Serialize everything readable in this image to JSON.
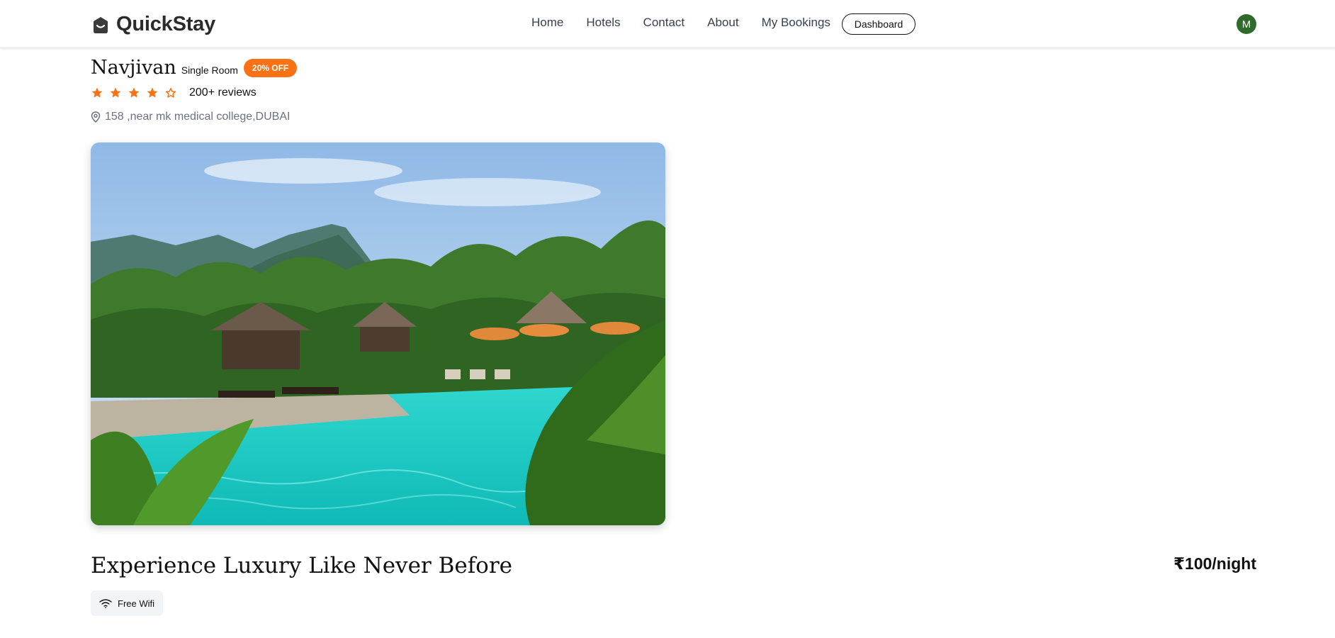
{
  "navbar": {
    "brand": "QuickStay",
    "links": [
      "Home",
      "Hotels",
      "Contact",
      "About",
      "My Bookings"
    ],
    "dashboard_label": "Dashboard",
    "avatar_initial": "M"
  },
  "hotel": {
    "name": "Navjivan",
    "room_type": "Single Room",
    "offer_badge": "20% OFF",
    "rating": 4,
    "reviews": "200+ reviews",
    "address": "158 ,near mk medical college,DUBAI",
    "tagline": "Experience Luxury Like Never Before",
    "price": "₹100/night",
    "amenities": [
      "Free Wifi"
    ]
  },
  "colors": {
    "accent": "#f97316",
    "avatar": "#2f6b2b",
    "pool": "#1ec9c2"
  },
  "icons": [
    "quickstay-logo-icon",
    "star-icon",
    "location-pin-icon",
    "wifi-icon"
  ]
}
